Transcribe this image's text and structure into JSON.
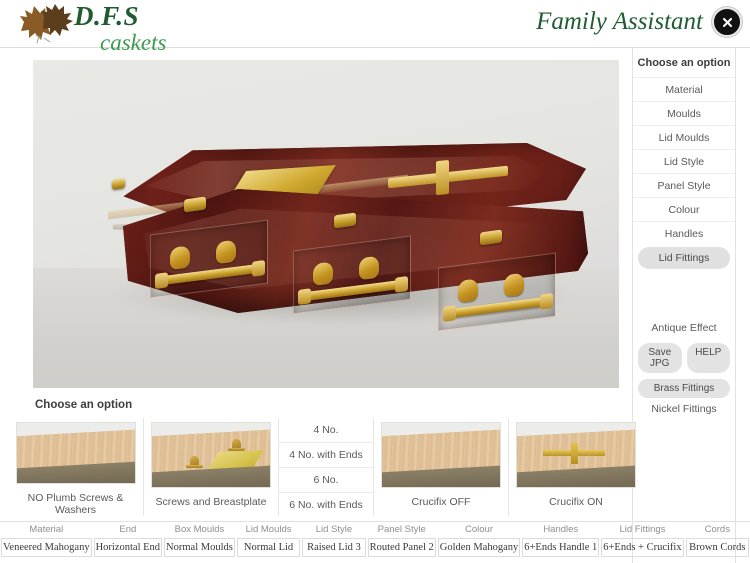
{
  "header": {
    "logo_primary": "D.F.S",
    "logo_secondary": "caskets",
    "logo_icon": "oak-leaves-icon",
    "app_title": "Family Assistant",
    "close_icon": "close-icon"
  },
  "sidebar": {
    "title": "Choose an option",
    "items": [
      {
        "label": "Material",
        "selected": false
      },
      {
        "label": "Moulds",
        "selected": false
      },
      {
        "label": "Lid Moulds",
        "selected": false
      },
      {
        "label": "Lid Style",
        "selected": false
      },
      {
        "label": "Panel Style",
        "selected": false
      },
      {
        "label": "Colour",
        "selected": false
      },
      {
        "label": "Handles",
        "selected": false
      },
      {
        "label": "Lid Fittings",
        "selected": true
      }
    ],
    "antique_effect": "Antique Effect",
    "save_jpg": "Save JPG",
    "help": "HELP",
    "brass_fittings": "Brass Fittings",
    "nickel_fittings": "Nickel Fittings"
  },
  "lower": {
    "title": "Choose an option",
    "thumbnails": [
      {
        "label": "NO Plumb Screws & Washers",
        "preview": "plain-wood"
      },
      {
        "label": "Screws and Breastplate",
        "preview": "screws-breastplate"
      }
    ],
    "list_options": [
      "4 No.",
      "4 No. with Ends",
      "6 No.",
      "6 No. with Ends"
    ],
    "crucifix_thumbnails": [
      {
        "label": "Crucifix OFF",
        "preview": "plain-wood"
      },
      {
        "label": "Crucifix ON",
        "preview": "crucifix"
      }
    ]
  },
  "summary": {
    "columns": [
      {
        "header": "Material",
        "value": "Veneered Mahogany"
      },
      {
        "header": "End",
        "value": "Horizontal End"
      },
      {
        "header": "Box Moulds",
        "value": "Normal Moulds"
      },
      {
        "header": "Lid Moulds",
        "value": "Normal Lid"
      },
      {
        "header": "Lid Style",
        "value": "Raised Lid 3"
      },
      {
        "header": "Panel Style",
        "value": "Routed Panel 2"
      },
      {
        "header": "Colour",
        "value": "Golden Mahogany"
      },
      {
        "header": "Handles",
        "value": "6+Ends Handle 1"
      },
      {
        "header": "Lid Fittings",
        "value": "6+Ends + Crucifix"
      },
      {
        "header": "Cords",
        "value": "Brown Cords"
      }
    ]
  },
  "viewer": {
    "alt": "casket-preview-image"
  },
  "colors": {
    "brand_dark_green": "#1f5c32",
    "brand_light_green": "#3a9a4f",
    "casket_mahogany": "#6b2018",
    "fittings_gold": "#cda42c",
    "selected_gray": "#e0e0e0"
  }
}
